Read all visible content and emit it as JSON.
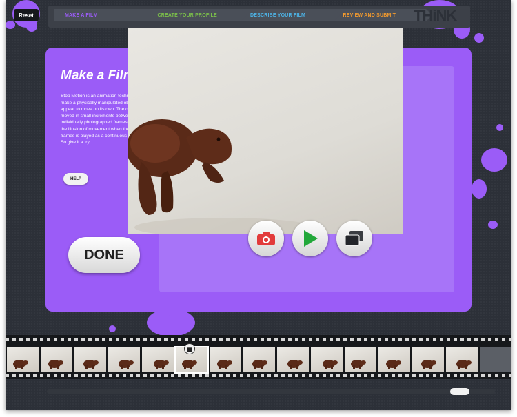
{
  "header": {
    "reset_label": "Reset",
    "logo_text": "THiNK",
    "steps": [
      {
        "label": "MAKE A FILM",
        "color": "#9b5cf7"
      },
      {
        "label": "CREATE YOUR PROFILE",
        "color": "#7bbf4a"
      },
      {
        "label": "DESCRIBE YOUR FILM",
        "color": "#4db3e6"
      },
      {
        "label": "REVIEW AND SUBMIT",
        "color": "#f29a2e"
      }
    ]
  },
  "panel": {
    "title": "Make a Film!",
    "description": "Stop Motion is an animation technique to make a physically manipulated object appear to move on its own. The object is moved in small increments between individually photographed frames, creating the illusion of movement when the series of frames is played as a continuous sequence. So give it a try!",
    "help_label": "HELP",
    "done_label": "DONE",
    "accent": "#9b5cf7"
  },
  "controls": {
    "capture_icon": "camera-icon",
    "play_icon": "play-icon",
    "onion_icon": "layers-icon"
  },
  "filmstrip": {
    "frame_count": 14,
    "selected_frame": 6,
    "delete_icon": "trash-icon"
  }
}
